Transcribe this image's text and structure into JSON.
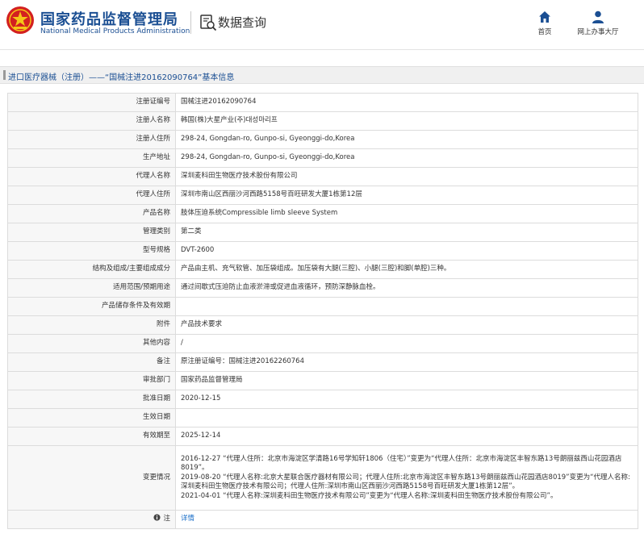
{
  "header": {
    "brand_cn": "国家药品监督管理局",
    "brand_en": "National Medical Products Administration",
    "query_label": "数据查询",
    "nav": [
      {
        "label": "首页",
        "icon": "home-icon"
      },
      {
        "label": "网上办事大厅",
        "icon": "user-icon"
      }
    ],
    "brand_color": "#1b4f93",
    "emblem_color": "#d32020"
  },
  "breadcrumb": "进口医疗器械（注册）——“国械注进20162090764”基本信息",
  "fields": [
    {
      "label": "注册证编号",
      "value": "国械注进20162090764"
    },
    {
      "label": "注册人名称",
      "value": "韩国(株)大星产业(주)대성마리프"
    },
    {
      "label": "注册人住所",
      "value": "298-24, Gongdan-ro, Gunpo-si, Gyeonggi-do,Korea"
    },
    {
      "label": "生产地址",
      "value": "298-24, Gongdan-ro, Gunpo-si, Gyeonggi-do,Korea"
    },
    {
      "label": "代理人名称",
      "value": "深圳麦科田生物医疗技术股份有限公司"
    },
    {
      "label": "代理人住所",
      "value": "深圳市南山区西丽沙河西路5158号百旺研发大厦1栋第12层"
    },
    {
      "label": "产品名称",
      "value": "肢体压迫系统Compressible limb sleeve System"
    },
    {
      "label": "管理类别",
      "value": "第二类"
    },
    {
      "label": "型号规格",
      "value": "DVT-2600"
    },
    {
      "label": "结构及组成/主要组成成分",
      "value": "产品由主机、充气软管、加压袋组成。加压袋有大腿(三腔)、小腿(三腔)和脚(单腔)三种。"
    },
    {
      "label": "适用范围/预期用途",
      "value": "通过间歇式压迫防止血液淤滞或促进血液循环，预防深静脉血栓。"
    },
    {
      "label": "产品储存条件及有效期",
      "value": ""
    },
    {
      "label": "附件",
      "value": "产品技术要求"
    },
    {
      "label": "其他内容",
      "value": "/"
    },
    {
      "label": "备注",
      "value": "原注册证编号：国械注进20162260764"
    },
    {
      "label": "审批部门",
      "value": "国家药品监督管理局"
    },
    {
      "label": "批准日期",
      "value": "2020-12-15"
    },
    {
      "label": "生效日期",
      "value": ""
    },
    {
      "label": "有效期至",
      "value": "2025-12-14"
    }
  ],
  "changes": {
    "label": "变更情况",
    "lines": [
      "2016-12-27 “代理人住所：北京市海淀区学清路16号学知轩1806（住宅）”变更为“代理人住所：北京市海淀区丰智东路13号朗丽兹西山花园酒店8019”。",
      "2019-08-20 “代理人名称:北京大星联合医疗器材有限公司；代理人住所:北京市海淀区丰智东路13号朗丽兹西山花园酒店8019”变更为“代理人名称:深圳麦科田生物医疗技术有限公司；代理人住所:深圳市南山区西丽沙河西路5158号百旺研发大厦1栋第12层”。",
      "2021-04-01 “代理人名称:深圳麦科田生物医疗技术有限公司”变更为“代理人名称:深圳麦科田生物医疗技术股份有限公司”。"
    ]
  },
  "note_row": {
    "label": "注",
    "link": "详情",
    "icon": "note-icon"
  }
}
